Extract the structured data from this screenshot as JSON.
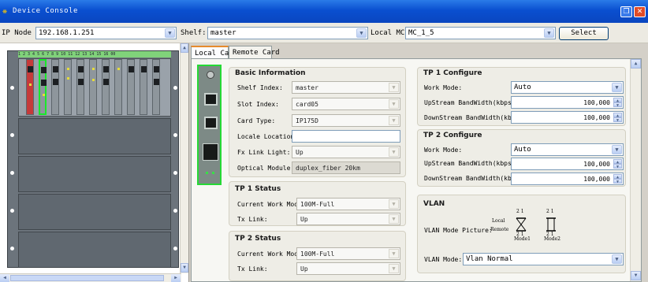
{
  "window": {
    "title": "Device Console"
  },
  "toolbar": {
    "ip_label": "IP Node",
    "ip_value": "192.168.1.251",
    "shelf_label": "Shelf:",
    "shelf_value": "master",
    "local_mc_label": "Local MC:",
    "local_mc_value": "MC_1_5",
    "select_label": "Select"
  },
  "shelf": {
    "slot_numbers": "1  2  3  4  5  6  7  8  9  10 11 12 13 14 15 16 00"
  },
  "tabs": [
    {
      "label": "Local Card"
    },
    {
      "label": "Remote Card"
    }
  ],
  "basic": {
    "title": "Basic Information",
    "shelf_index_label": "Shelf Index:",
    "shelf_index": "master",
    "slot_index_label": "Slot Index:",
    "slot_index": "card05",
    "card_type_label": "Card Type:",
    "card_type": "IP175D",
    "locale_label": "Locale Location:",
    "locale": "",
    "fx_link_label": "Fx Link Light:",
    "fx_link": "Up",
    "optical_label": "Optical Module:",
    "optical": "duplex_fiber 20km"
  },
  "tp1_status": {
    "title": "TP 1 Status",
    "work_mode_label": "Current Work Mode:",
    "work_mode": "100M-Full",
    "tx_label": "Tx Link:",
    "tx": "Up"
  },
  "tp2_status": {
    "title": "TP 2 Status",
    "work_mode_label": "Current Work Mode:",
    "work_mode": "100M-Full",
    "tx_label": "Tx Link:",
    "tx": "Up"
  },
  "tp1_conf": {
    "title": "TP 1 Configure",
    "work_mode_label": "Work Mode:",
    "work_mode": "Auto",
    "up_label": "UpStream BandWidth(kbps):",
    "up": "100,000",
    "down_label": "DownStream BandWidth(kbps):",
    "down": "100,000"
  },
  "tp2_conf": {
    "title": "TP 2 Configure",
    "work_mode_label": "Work Mode:",
    "work_mode": "Auto",
    "up_label": "UpStream BandWidth(kbps):",
    "up": "100,000",
    "down_label": "DownStream BandWidth(kbps):",
    "down": "100,000"
  },
  "vlan": {
    "title": "VLAN",
    "picture_label": "VLAN Mode Picture:",
    "local": "Local",
    "remote": "Remote",
    "mode1": "Mode1",
    "mode2": "Mode2",
    "pic_top": "2 1",
    "pic_bottom": "2 1",
    "mode_label": "VLAN Mode:",
    "mode": "Vlan Normal"
  }
}
